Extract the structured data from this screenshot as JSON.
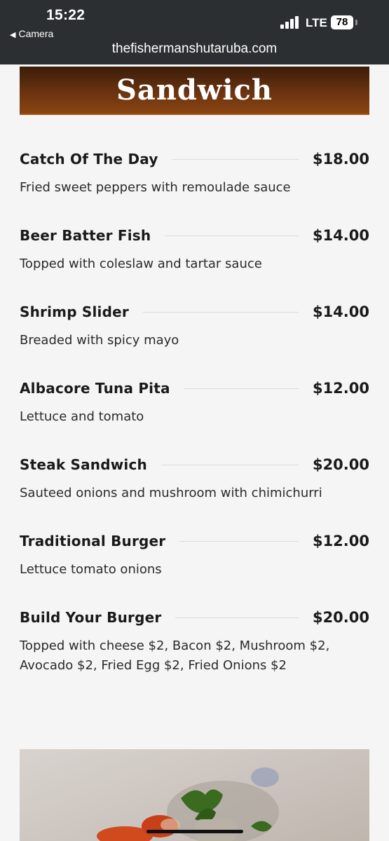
{
  "status_bar": {
    "time": "15:22",
    "back_label": "Camera",
    "network": "LTE",
    "battery": "78"
  },
  "browser": {
    "url": "thefishermanshutaruba.com"
  },
  "section": {
    "title": "Sandwich"
  },
  "items": [
    {
      "name": "Catch Of The Day",
      "price": "$18.00",
      "description": "Fried sweet peppers with remoulade sauce"
    },
    {
      "name": "Beer Batter Fish",
      "price": "$14.00",
      "description": "Topped with coleslaw and tartar sauce"
    },
    {
      "name": "Shrimp Slider",
      "price": "$14.00",
      "description": "Breaded with spicy mayo"
    },
    {
      "name": "Albacore Tuna Pita",
      "price": "$12.00",
      "description": "Lettuce and tomato"
    },
    {
      "name": "Steak Sandwich",
      "price": "$20.00",
      "description": "Sauteed onions and mushroom with chimichurri"
    },
    {
      "name": "Traditional Burger",
      "price": "$12.00",
      "description": "Lettuce tomato onions"
    },
    {
      "name": "Build Your Burger",
      "price": "$20.00",
      "description": "Topped with cheese $2, Bacon $2, Mushroom $2, Avocado $2, Fried Egg $2, Fried Onions $2"
    }
  ],
  "colors": {
    "banner": "#6b3310",
    "topbar": "#2c2f31"
  }
}
